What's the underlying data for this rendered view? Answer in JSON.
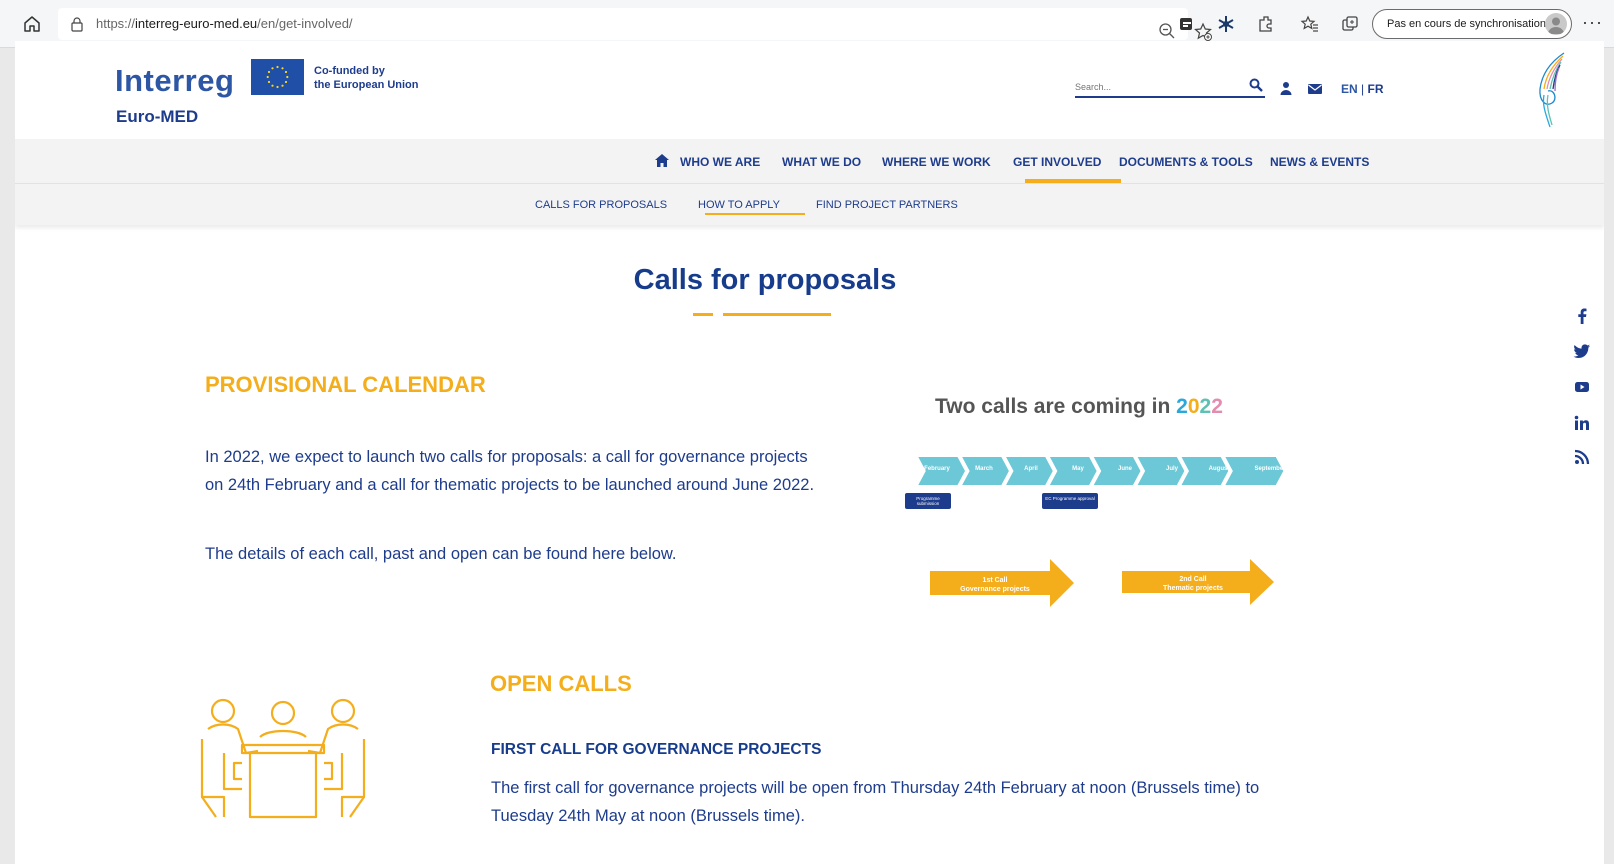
{
  "browser": {
    "url_proto": "https://",
    "url_domain": "interreg-euro-med.eu",
    "url_path": "/en/get-involved/",
    "sync_label": "Pas en cours de synchronisation",
    "more_label": "···"
  },
  "header": {
    "logo_main": "Interreg",
    "logo_sub": "Euro-MED",
    "eu_line1": "Co-funded by",
    "eu_line2": "the European Union",
    "search_placeholder": "Search...",
    "lang_en": "EN",
    "lang_sep": "|",
    "lang_fr": "FR"
  },
  "main_nav": {
    "items": [
      "WHO WE ARE",
      "WHAT WE DO",
      "WHERE WE WORK",
      "GET INVOLVED",
      "DOCUMENTS & TOOLS",
      "NEWS & EVENTS"
    ],
    "active": "GET INVOLVED"
  },
  "sub_nav": {
    "items": [
      "CALLS FOR PROPOSALS",
      "HOW TO APPLY",
      "FIND PROJECT PARTNERS"
    ],
    "active": "HOW TO APPLY"
  },
  "page": {
    "title": "Calls for proposals",
    "calendar_heading": "PROVISIONAL CALENDAR",
    "calendar_p1": "In 2022, we expect to launch two calls for proposals: a call for governance projects on 24th February and a call for thematic projects to be launched around June 2022.",
    "calendar_p2": "The details of each call, past and open can be found here below.",
    "open_heading": "OPEN CALLS",
    "first_call_heading": "FIRST CALL FOR GOVERNANCE PROJECTS",
    "first_call_text": "The first call for governance projects will be open from Thursday 24th February at noon (Brussels time) to Tuesday 24th May at noon (Brussels time)."
  },
  "infographic": {
    "title_prefix": "Two calls are coming in ",
    "year_digits": [
      "2",
      "0",
      "2",
      "2"
    ],
    "months": [
      "February",
      "March",
      "April",
      "May",
      "June",
      "July",
      "August",
      "September"
    ],
    "milestone1": "Programme submission",
    "milestone2": "EC Programme approval",
    "call1_line1": "1st Call",
    "call1_line2": "Governance projects",
    "call2_line1": "2nd Call",
    "call2_line2": "Thematic projects"
  },
  "colors": {
    "navy": "#1e3c8c",
    "accent": "#f4ad1b",
    "chevron": "#6cc7d6"
  },
  "social": [
    "facebook-icon",
    "twitter-icon",
    "youtube-icon",
    "linkedin-icon",
    "rss-icon"
  ]
}
